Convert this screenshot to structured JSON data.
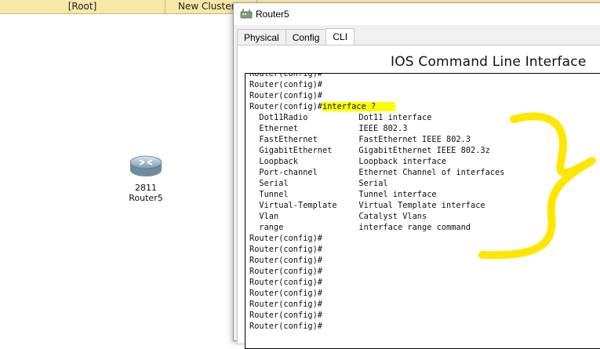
{
  "topbar": {
    "root_label": "[Root]",
    "cluster_label": "New Cluster"
  },
  "workspace": {
    "device": {
      "model": "2811",
      "name": "Router5",
      "icon": "router-icon"
    }
  },
  "window": {
    "title": "Router5",
    "tabs": [
      {
        "label": "Physical"
      },
      {
        "label": "Config"
      },
      {
        "label": "CLI",
        "active": true
      }
    ],
    "panel_heading": "IOS Command Line Interface",
    "terminal": {
      "prompt": "Router(config)#",
      "command": "interface ?",
      "top_partial_line": "Router(config)#",
      "pre_lines": [
        "Router(config)#",
        "Router(config)#"
      ],
      "help_rows": [
        {
          "keyword": "Dot11Radio",
          "desc": "Dot11 interface"
        },
        {
          "keyword": "Ethernet",
          "desc": "IEEE 802.3"
        },
        {
          "keyword": "FastEthernet",
          "desc": "FastEthernet IEEE 802.3"
        },
        {
          "keyword": "GigabitEthernet",
          "desc": "GigabitEthernet IEEE 802.3z"
        },
        {
          "keyword": "Loopback",
          "desc": "Loopback interface"
        },
        {
          "keyword": "Port-channel",
          "desc": "Ethernet Channel of interfaces"
        },
        {
          "keyword": "Serial",
          "desc": "Serial"
        },
        {
          "keyword": "Tunnel",
          "desc": "Tunnel interface"
        },
        {
          "keyword": "Virtual-Template",
          "desc": "Virtual Template interface"
        },
        {
          "keyword": "Vlan",
          "desc": "Catalyst Vlans"
        },
        {
          "keyword": "range",
          "desc": "interface range command"
        }
      ],
      "post_lines": [
        "Router(config)#",
        "Router(config)#",
        "Router(config)#",
        "Router(config)#",
        "Router(config)#",
        "Router(config)#",
        "Router(config)#",
        "Router(config)#",
        "Router(config)#"
      ]
    },
    "annotation": {
      "color": "#ffe600",
      "shape": "curly-brace"
    }
  }
}
